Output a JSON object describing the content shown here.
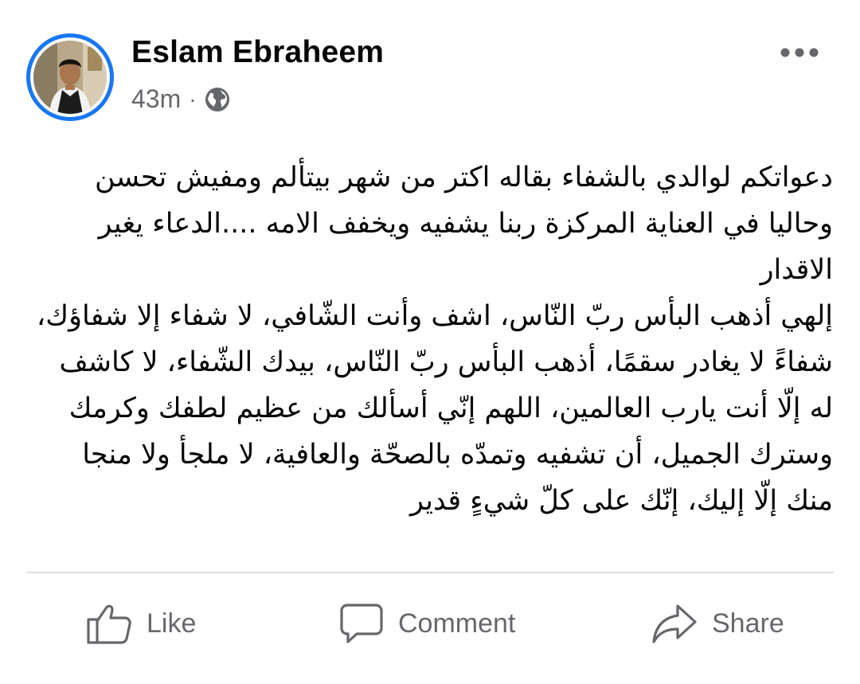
{
  "post": {
    "author_name": "Eslam Ebraheem",
    "timestamp": "43m",
    "separator": "·",
    "privacy_icon": "globe-icon",
    "more_icon": "ellipsis-icon",
    "text_paragraphs": [
      "دعواتكم لوالدي بالشفاء بقاله اكتر من شهر بيتألم ومفيش تحسن وحاليا في العناية المركزة ربنا يشفيه ويخفف الامه ....الدعاء يغير الاقدار",
      "إلهي أذهب البأس ربّ النّاس، اشف وأنت الشّافي، لا شفاء إلا شفاؤك، شفاءً لا يغادر سقمًا، أذهب البأس ربّ النّاس، بيدك الشّفاء، لا كاشف له إلّا أنت يارب العالمين، اللهم إنّي أسألك من عظيم لطفك وكرمك وسترك الجميل، أن تشفيه وتمدّه بالصحّة والعافية، لا ملجأ ولا منجا منك إلّا إليك، إنّك على كلّ شيءٍ قدير"
    ]
  },
  "actions": {
    "like_label": "Like",
    "comment_label": "Comment",
    "share_label": "Share"
  },
  "colors": {
    "story_ring": "#1877f2",
    "secondary_text": "#65676b",
    "primary_text": "#050505",
    "divider": "#dadde1"
  }
}
